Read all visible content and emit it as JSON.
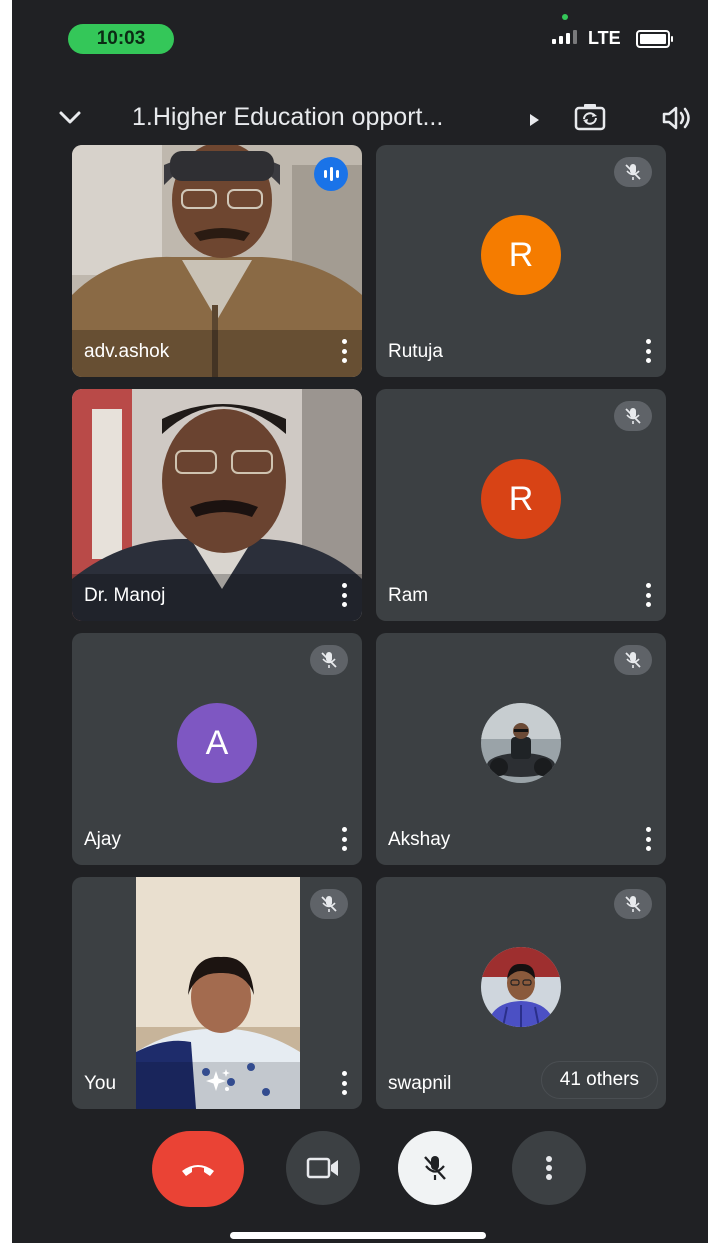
{
  "status_bar": {
    "time": "10:03",
    "network": "LTE"
  },
  "meeting": {
    "title": "1.Higher Education opport..."
  },
  "participants": [
    {
      "name": "adv.ashok",
      "speaking": true
    },
    {
      "name": "Rutuja",
      "initial": "R",
      "avatar_color": "#f57c00"
    },
    {
      "name": "Dr. Manoj"
    },
    {
      "name": "Ram",
      "initial": "R",
      "avatar_color": "#d84315"
    },
    {
      "name": "Ajay",
      "initial": "A",
      "avatar_color": "#7e57c2"
    },
    {
      "name": "Akshay"
    },
    {
      "name": "You"
    },
    {
      "name": "swapnil",
      "others_label": "41 others"
    }
  ],
  "controls": [
    "end-call",
    "camera",
    "microphone",
    "more-options"
  ],
  "colors": {
    "background": "#202124",
    "tile": "#3c4043",
    "end_call": "#ea4335",
    "speaking": "#1a73e8"
  }
}
